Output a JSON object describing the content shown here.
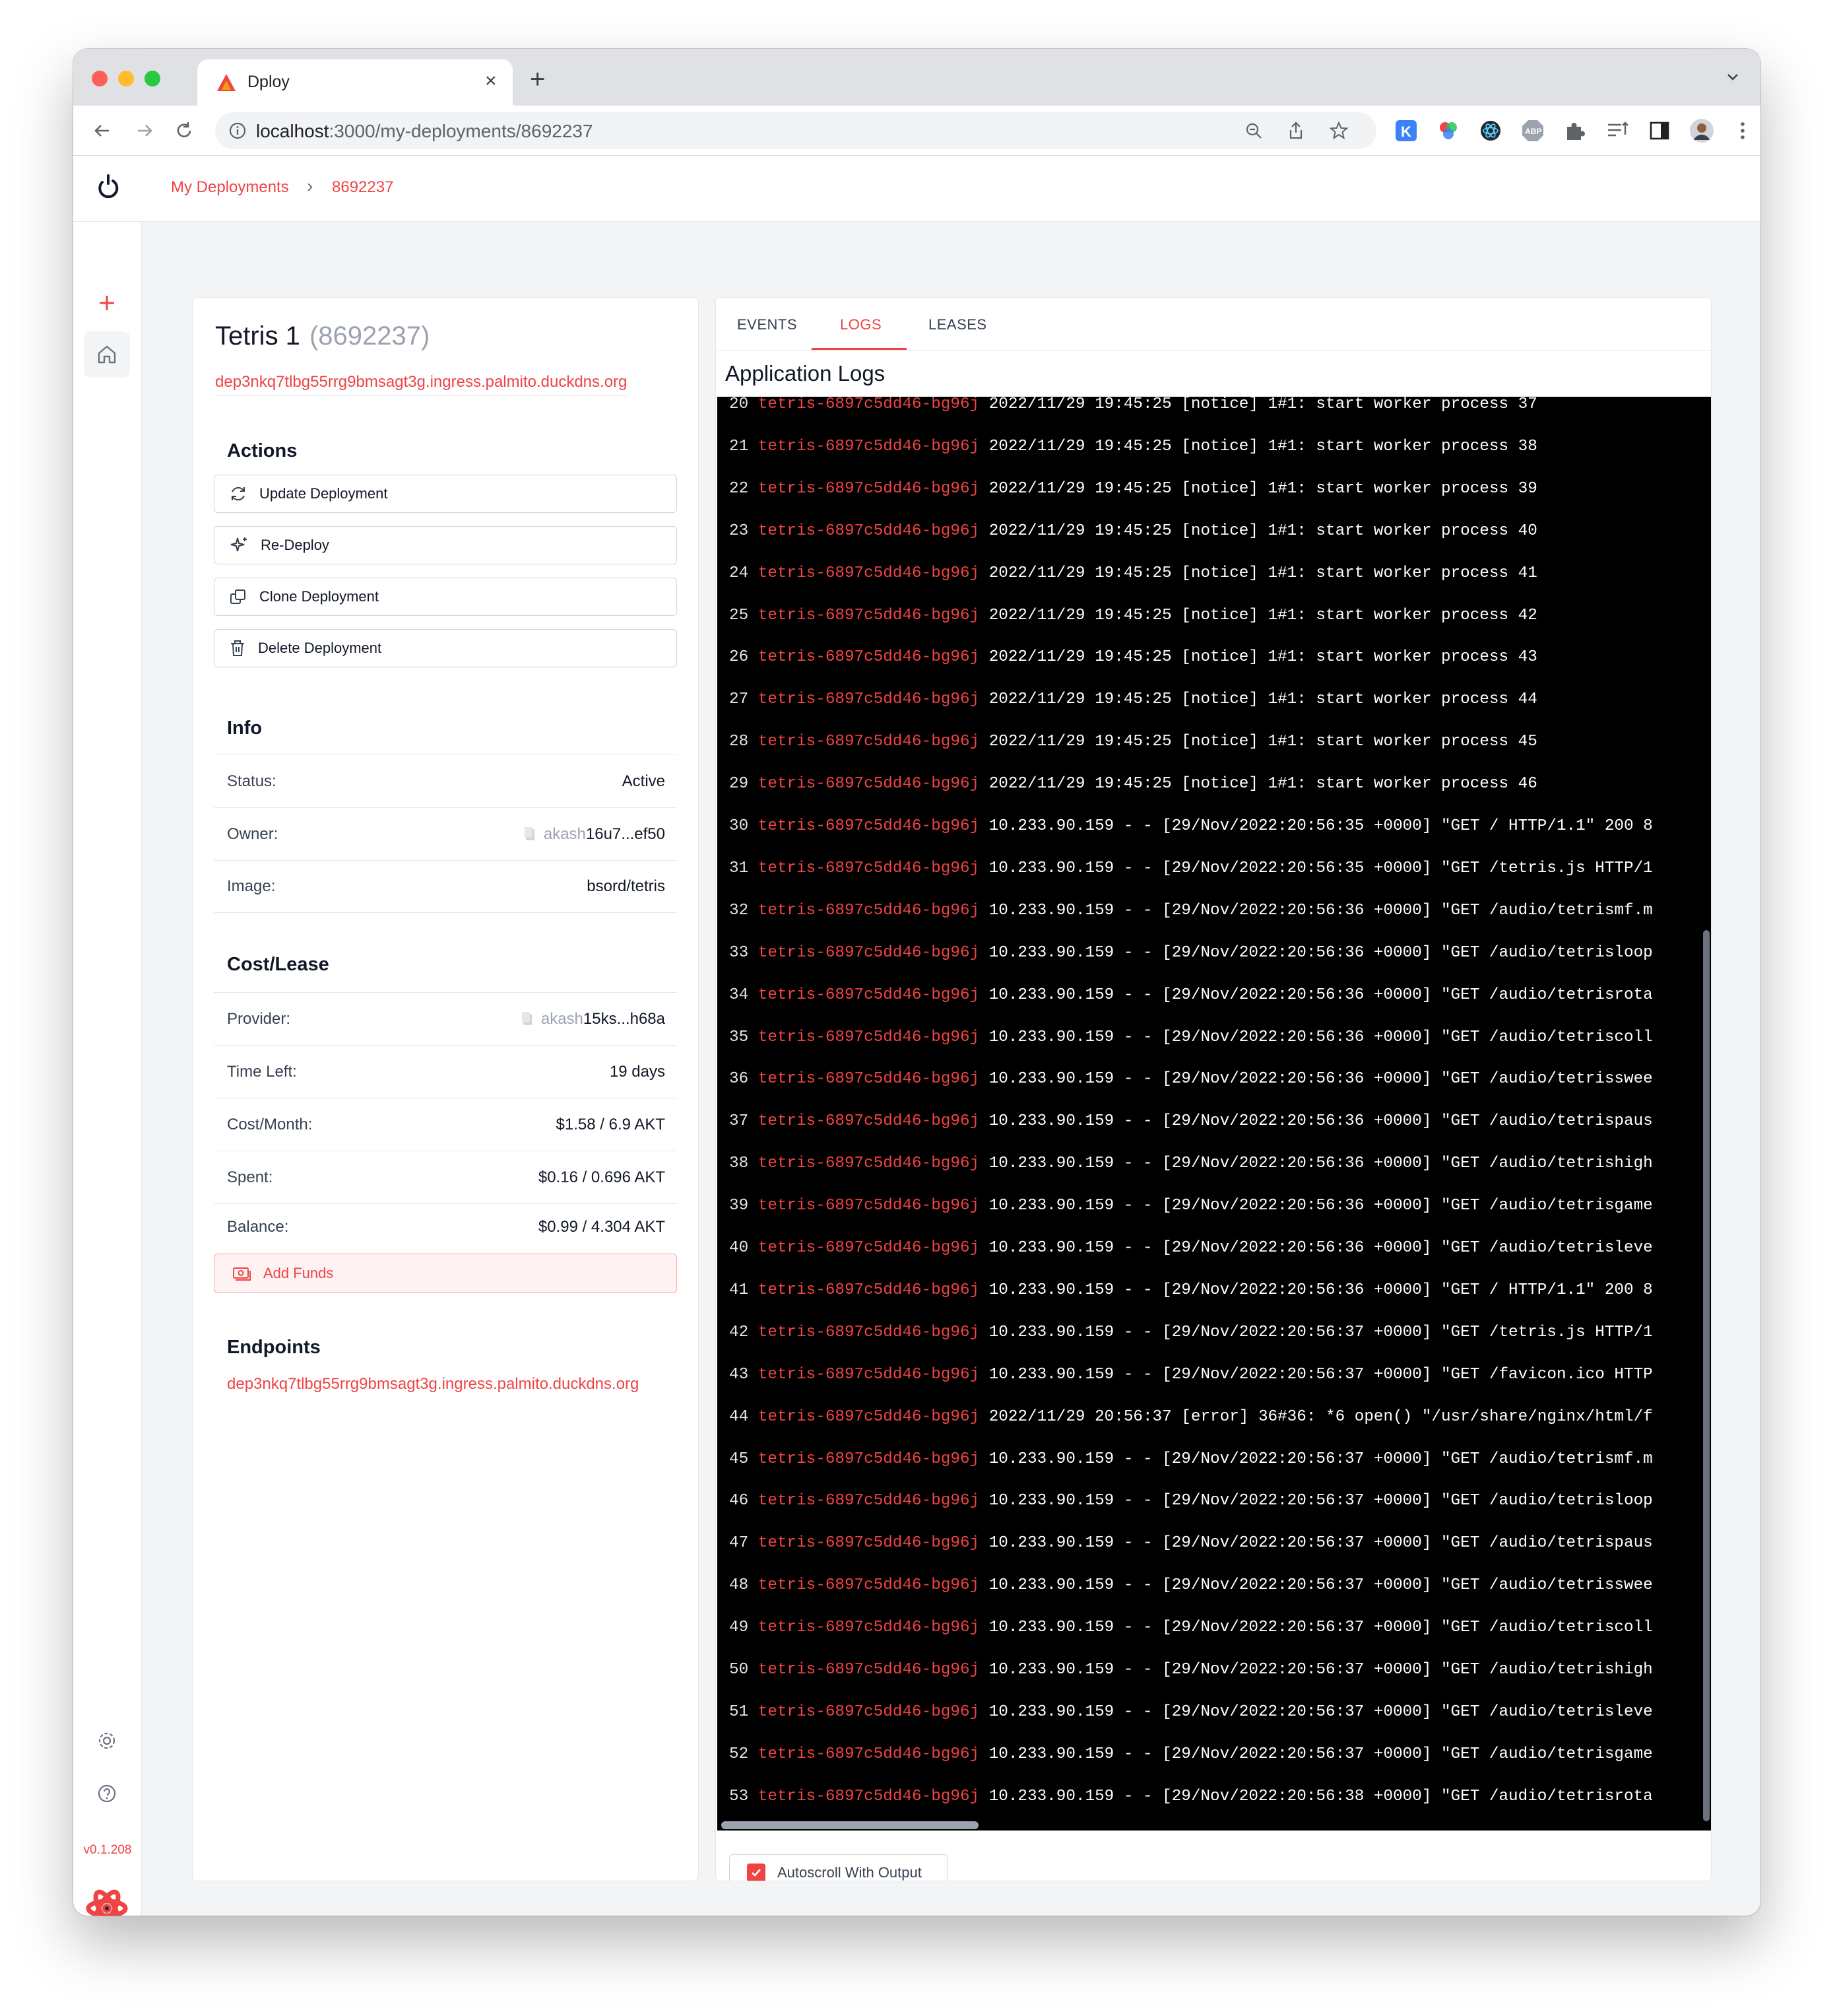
{
  "browser": {
    "tab_title": "Dploy",
    "url_host": "localhost",
    "url_path": ":3000/my-deployments/8692237"
  },
  "breadcrumb": {
    "root": "My Deployments",
    "separator": "›",
    "current": "8692237"
  },
  "sidebar": {
    "version": "v0.1.208"
  },
  "deployment": {
    "name": "Tetris 1",
    "dseq": "(8692237)",
    "uri": "dep3nkq7tlbg55rrg9bmsagt3g.ingress.palmito.duckdns.org"
  },
  "actions": {
    "heading": "Actions",
    "update": "Update Deployment",
    "redeploy": "Re-Deploy",
    "clone": "Clone Deployment",
    "delete": "Delete Deployment"
  },
  "info": {
    "heading": "Info",
    "status_label": "Status:",
    "status_value": "Active",
    "owner_label": "Owner:",
    "owner_prefix": "akash",
    "owner_value": "16u7...ef50",
    "image_label": "Image:",
    "image_value": "bsord/tetris"
  },
  "cost": {
    "heading": "Cost/Lease",
    "provider_label": "Provider:",
    "provider_prefix": "akash",
    "provider_value": "15ks...h68a",
    "time_left_label": "Time Left:",
    "time_left_value": "19 days",
    "cost_month_label": "Cost/Month:",
    "cost_month_value": "$1.58 / 6.9 AKT",
    "spent_label": "Spent:",
    "spent_value": "$0.16 / 0.696 AKT",
    "balance_label": "Balance:",
    "balance_value": "$0.99 / 4.304 AKT",
    "add_funds": "Add Funds"
  },
  "endpoints": {
    "heading": "Endpoints",
    "url": "dep3nkq7tlbg55rrg9bmsagt3g.ingress.palmito.duckdns.org"
  },
  "tabs": {
    "events": "EVENTS",
    "logs": "LOGS",
    "leases": "LEASES",
    "active": "LOGS"
  },
  "logs": {
    "title": "Application Logs",
    "autoscroll_label": "Autoscroll With Output",
    "autoscroll_checked": true,
    "pod": "tetris-6897c5dd46-bg96j",
    "lines": [
      {
        "n": "20",
        "msg": "2022/11/29 19:45:25 [notice] 1#1: start worker process 37"
      },
      {
        "n": "21",
        "msg": "2022/11/29 19:45:25 [notice] 1#1: start worker process 38"
      },
      {
        "n": "22",
        "msg": "2022/11/29 19:45:25 [notice] 1#1: start worker process 39"
      },
      {
        "n": "23",
        "msg": "2022/11/29 19:45:25 [notice] 1#1: start worker process 40"
      },
      {
        "n": "24",
        "msg": "2022/11/29 19:45:25 [notice] 1#1: start worker process 41"
      },
      {
        "n": "25",
        "msg": "2022/11/29 19:45:25 [notice] 1#1: start worker process 42"
      },
      {
        "n": "26",
        "msg": "2022/11/29 19:45:25 [notice] 1#1: start worker process 43"
      },
      {
        "n": "27",
        "msg": "2022/11/29 19:45:25 [notice] 1#1: start worker process 44"
      },
      {
        "n": "28",
        "msg": "2022/11/29 19:45:25 [notice] 1#1: start worker process 45"
      },
      {
        "n": "29",
        "msg": "2022/11/29 19:45:25 [notice] 1#1: start worker process 46"
      },
      {
        "n": "30",
        "msg": "10.233.90.159 - - [29/Nov/2022:20:56:35 +0000] \"GET / HTTP/1.1\" 200 8"
      },
      {
        "n": "31",
        "msg": "10.233.90.159 - - [29/Nov/2022:20:56:35 +0000] \"GET /tetris.js HTTP/1"
      },
      {
        "n": "32",
        "msg": "10.233.90.159 - - [29/Nov/2022:20:56:36 +0000] \"GET /audio/tetrismf.m"
      },
      {
        "n": "33",
        "msg": "10.233.90.159 - - [29/Nov/2022:20:56:36 +0000] \"GET /audio/tetrisloop"
      },
      {
        "n": "34",
        "msg": "10.233.90.159 - - [29/Nov/2022:20:56:36 +0000] \"GET /audio/tetrisrota"
      },
      {
        "n": "35",
        "msg": "10.233.90.159 - - [29/Nov/2022:20:56:36 +0000] \"GET /audio/tetriscoll"
      },
      {
        "n": "36",
        "msg": "10.233.90.159 - - [29/Nov/2022:20:56:36 +0000] \"GET /audio/tetrisswee"
      },
      {
        "n": "37",
        "msg": "10.233.90.159 - - [29/Nov/2022:20:56:36 +0000] \"GET /audio/tetrispaus"
      },
      {
        "n": "38",
        "msg": "10.233.90.159 - - [29/Nov/2022:20:56:36 +0000] \"GET /audio/tetrishigh"
      },
      {
        "n": "39",
        "msg": "10.233.90.159 - - [29/Nov/2022:20:56:36 +0000] \"GET /audio/tetrisgame"
      },
      {
        "n": "40",
        "msg": "10.233.90.159 - - [29/Nov/2022:20:56:36 +0000] \"GET /audio/tetrisleve"
      },
      {
        "n": "41",
        "msg": "10.233.90.159 - - [29/Nov/2022:20:56:36 +0000] \"GET / HTTP/1.1\" 200 8"
      },
      {
        "n": "42",
        "msg": "10.233.90.159 - - [29/Nov/2022:20:56:37 +0000] \"GET /tetris.js HTTP/1"
      },
      {
        "n": "43",
        "msg": "10.233.90.159 - - [29/Nov/2022:20:56:37 +0000] \"GET /favicon.ico HTTP"
      },
      {
        "n": "44",
        "msg": "2022/11/29 20:56:37 [error] 36#36: *6 open() \"/usr/share/nginx/html/f"
      },
      {
        "n": "45",
        "msg": "10.233.90.159 - - [29/Nov/2022:20:56:37 +0000] \"GET /audio/tetrismf.m"
      },
      {
        "n": "46",
        "msg": "10.233.90.159 - - [29/Nov/2022:20:56:37 +0000] \"GET /audio/tetrisloop"
      },
      {
        "n": "47",
        "msg": "10.233.90.159 - - [29/Nov/2022:20:56:37 +0000] \"GET /audio/tetrispaus"
      },
      {
        "n": "48",
        "msg": "10.233.90.159 - - [29/Nov/2022:20:56:37 +0000] \"GET /audio/tetrisswee"
      },
      {
        "n": "49",
        "msg": "10.233.90.159 - - [29/Nov/2022:20:56:37 +0000] \"GET /audio/tetriscoll"
      },
      {
        "n": "50",
        "msg": "10.233.90.159 - - [29/Nov/2022:20:56:37 +0000] \"GET /audio/tetrishigh"
      },
      {
        "n": "51",
        "msg": "10.233.90.159 - - [29/Nov/2022:20:56:37 +0000] \"GET /audio/tetrisleve"
      },
      {
        "n": "52",
        "msg": "10.233.90.159 - - [29/Nov/2022:20:56:37 +0000] \"GET /audio/tetrisgame"
      },
      {
        "n": "53",
        "msg": "10.233.90.159 - - [29/Nov/2022:20:56:38 +0000] \"GET /audio/tetrisrota"
      }
    ]
  },
  "colors": {
    "accent": "#ef4444",
    "terminal_bg": "#000000",
    "page_bg": "#f3f4f6"
  }
}
